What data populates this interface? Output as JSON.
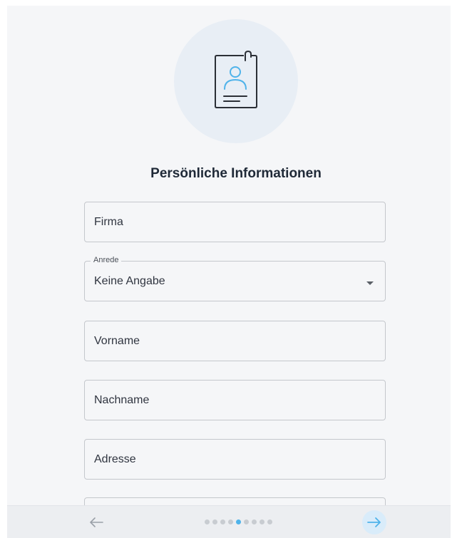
{
  "form": {
    "title": "Persönliche Informationen",
    "fields": [
      {
        "value": "Firma"
      },
      {
        "label": "Anrede",
        "value": "Keine Angabe"
      },
      {
        "value": "Vorname"
      },
      {
        "value": "Nachname"
      },
      {
        "value": "Adresse"
      }
    ]
  },
  "pagination": {
    "total_steps": 9,
    "current_step": 5
  },
  "icons": {
    "hero": "id-card-icon",
    "back": "arrow-left-icon",
    "next": "arrow-right-icon",
    "select": "chevron-down-icon"
  },
  "colors": {
    "accent": "#4fb3ea",
    "hero_circle": "#e8eef5",
    "card_background": "#f5f6f8",
    "icon_stroke": "#2b2f36"
  }
}
